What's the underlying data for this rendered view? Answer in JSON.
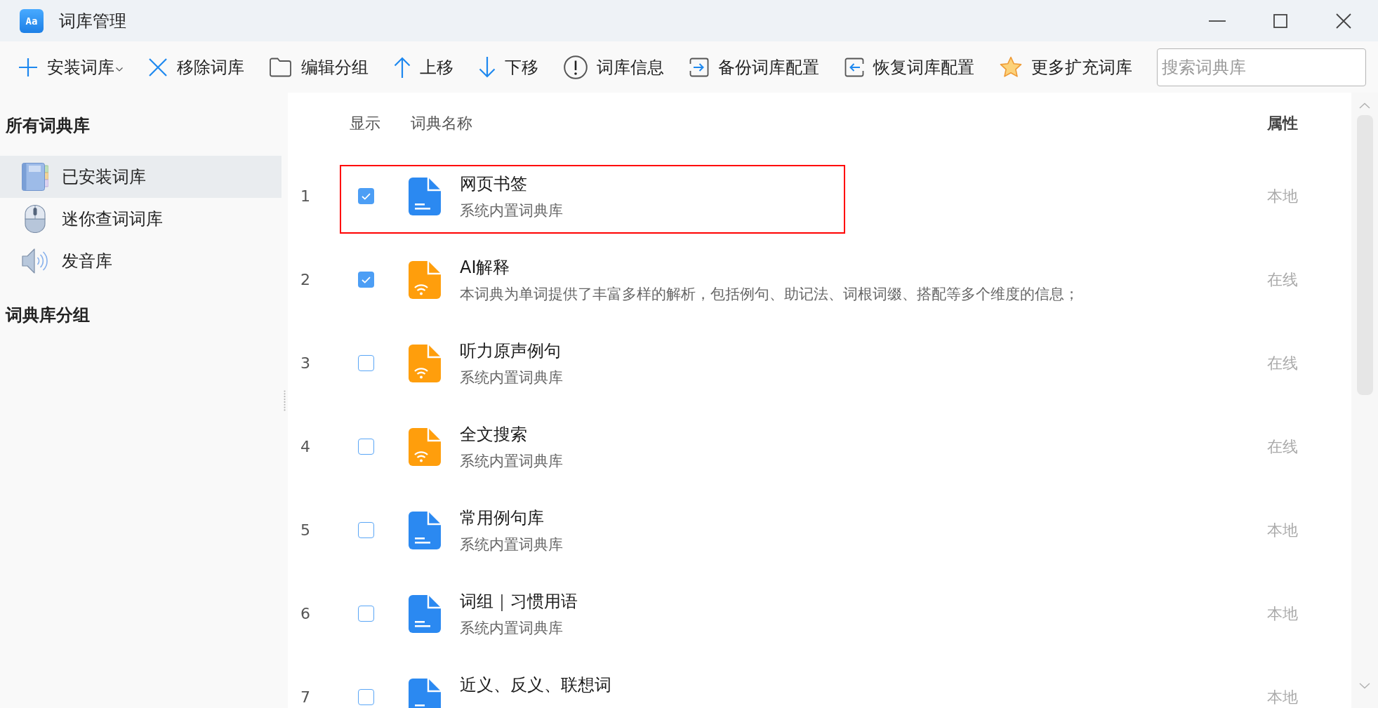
{
  "window": {
    "title": "词库管理",
    "icon_label": "Aa"
  },
  "toolbar": [
    {
      "kind": "add",
      "label": "安装词库",
      "dropdown": true
    },
    {
      "kind": "remove",
      "label": "移除词库",
      "dropdown": false
    },
    {
      "kind": "folder",
      "label": "编辑分组",
      "dropdown": false
    },
    {
      "kind": "up",
      "label": "上移",
      "dropdown": false
    },
    {
      "kind": "down",
      "label": "下移",
      "dropdown": false
    },
    {
      "kind": "info",
      "label": "词库信息",
      "dropdown": false
    },
    {
      "kind": "backup",
      "label": "备份词库配置",
      "dropdown": false
    },
    {
      "kind": "restore",
      "label": "恢复词库配置",
      "dropdown": false
    },
    {
      "kind": "star",
      "label": "更多扩充词库",
      "dropdown": false
    }
  ],
  "search": {
    "placeholder": "搜索词典库"
  },
  "sidebar": {
    "title": "所有词典库",
    "items": [
      {
        "kind": "book",
        "label": "已安装词库",
        "selected": true
      },
      {
        "kind": "mouse",
        "label": "迷你查词词库",
        "selected": false
      },
      {
        "kind": "speaker",
        "label": "发音库",
        "selected": false
      }
    ],
    "groups_title": "词典库分组"
  },
  "table": {
    "columns": [
      "显示",
      "词典名称",
      "属性"
    ],
    "rows": [
      {
        "number": "1",
        "checked": true,
        "kind": "local",
        "name": "网页书签",
        "description": "系统内置词典库",
        "attribute": "本地",
        "highlighted": true
      },
      {
        "number": "2",
        "checked": true,
        "kind": "online",
        "name": "AI解释",
        "description": "本词典为单词提供了丰富多样的解析，包括例句、助记法、词根词缀、搭配等多个维度的信息；",
        "attribute": "在线",
        "highlighted": false
      },
      {
        "number": "3",
        "checked": false,
        "kind": "online",
        "name": "听力原声例句",
        "description": "系统内置词典库",
        "attribute": "在线",
        "highlighted": false
      },
      {
        "number": "4",
        "checked": false,
        "kind": "online",
        "name": "全文搜索",
        "description": "系统内置词典库",
        "attribute": "在线",
        "highlighted": false
      },
      {
        "number": "5",
        "checked": false,
        "kind": "local",
        "name": "常用例句库",
        "description": "系统内置词典库",
        "attribute": "本地",
        "highlighted": false
      },
      {
        "number": "6",
        "checked": false,
        "kind": "local",
        "name": "词组｜习惯用语",
        "description": "系统内置词典库",
        "attribute": "本地",
        "highlighted": false
      },
      {
        "number": "7",
        "checked": false,
        "kind": "local",
        "name": "近义、反义、联想词",
        "attribute": "本地",
        "highlighted": false
      }
    ]
  }
}
